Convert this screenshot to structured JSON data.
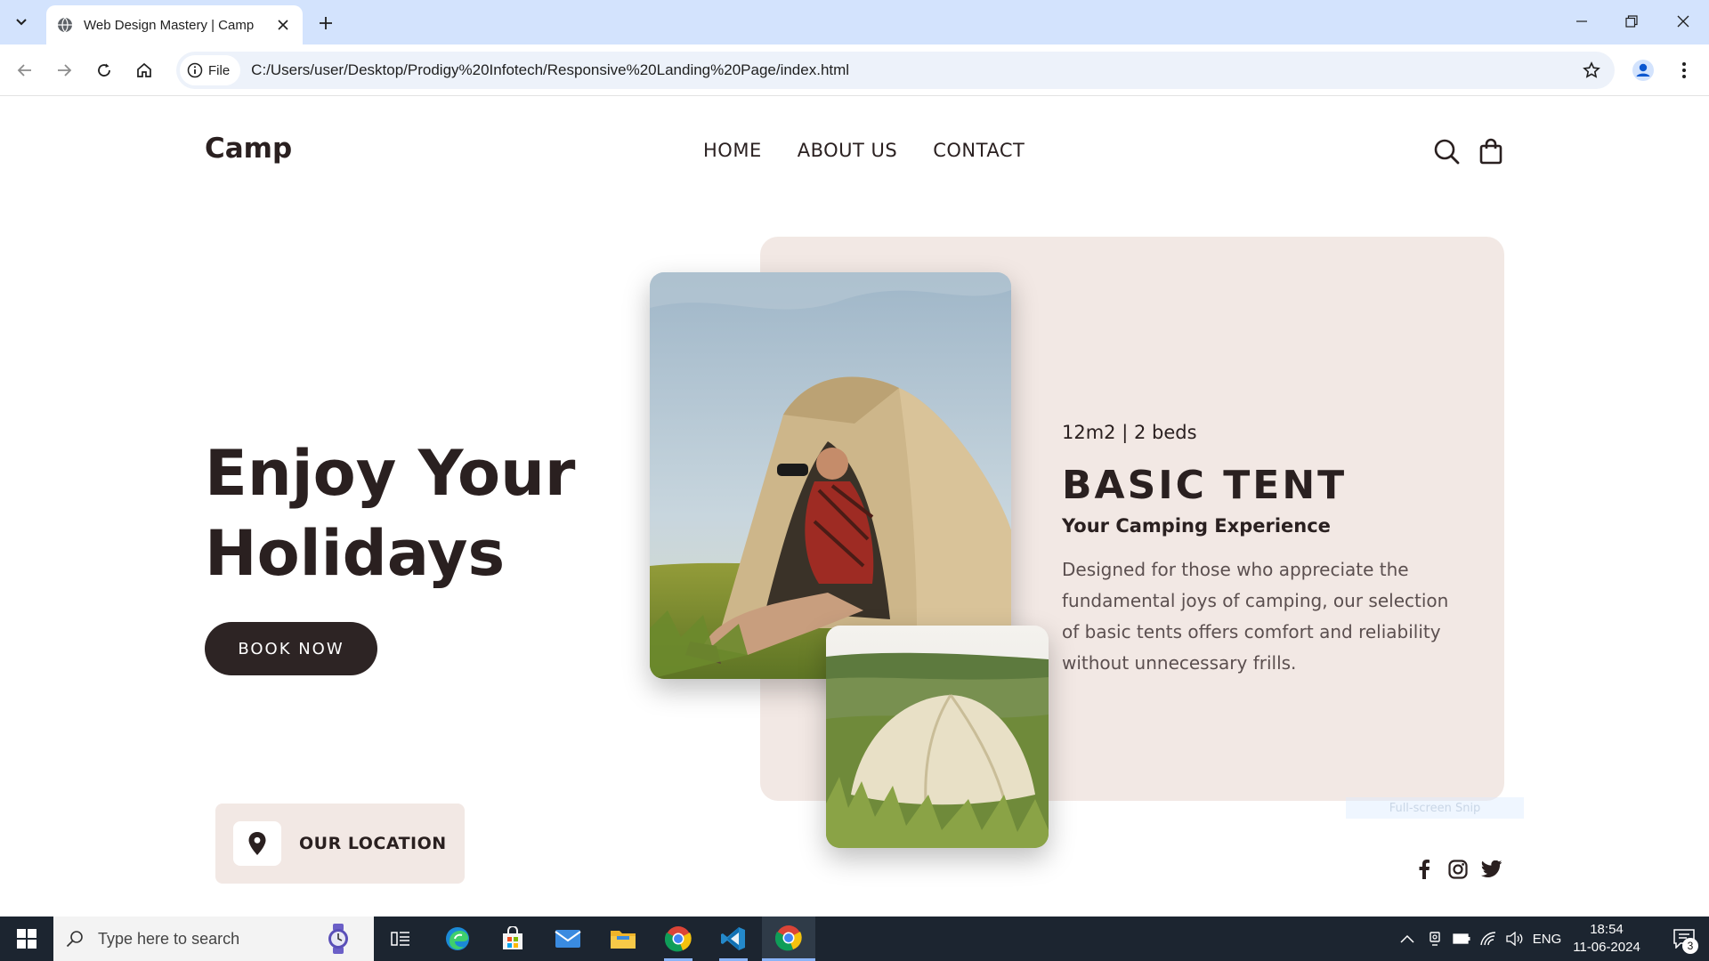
{
  "browser": {
    "tab_title": "Web Design Mastery | Camp",
    "site_info_label": "File",
    "url": "C:/Users/user/Desktop/Prodigy%20Infotech/Responsive%20Landing%20Page/index.html"
  },
  "site": {
    "logo": "Camp",
    "nav": [
      "HOME",
      "ABOUT US",
      "CONTACT"
    ],
    "hero": {
      "line1": "Enjoy Your",
      "line2": "Holidays",
      "cta": "BOOK NOW"
    },
    "location": "OUR LOCATION",
    "card": {
      "meta": "12m2 | 2 beds",
      "title": "BASIC TENT",
      "subtitle": "Your Camping Experience",
      "description": "Designed for those who appreciate the fundamental joys of camping, our selection of basic tents offers comfort and reliability without unnecessary frills."
    },
    "snip_overlay": "Full-screen Snip",
    "socials": [
      "facebook-icon",
      "instagram-icon",
      "twitter-icon"
    ],
    "colors": {
      "accent_dark": "#2d2424",
      "card_bg": "#f2e8e4",
      "text": "#2a2020"
    }
  },
  "taskbar": {
    "search_placeholder": "Type here to search",
    "apps": [
      "task-view",
      "edge",
      "store",
      "mail",
      "file-explorer",
      "chrome",
      "vscode",
      "chrome"
    ],
    "language": "ENG",
    "time": "18:54",
    "date": "11-06-2024",
    "notification_count": "3"
  }
}
